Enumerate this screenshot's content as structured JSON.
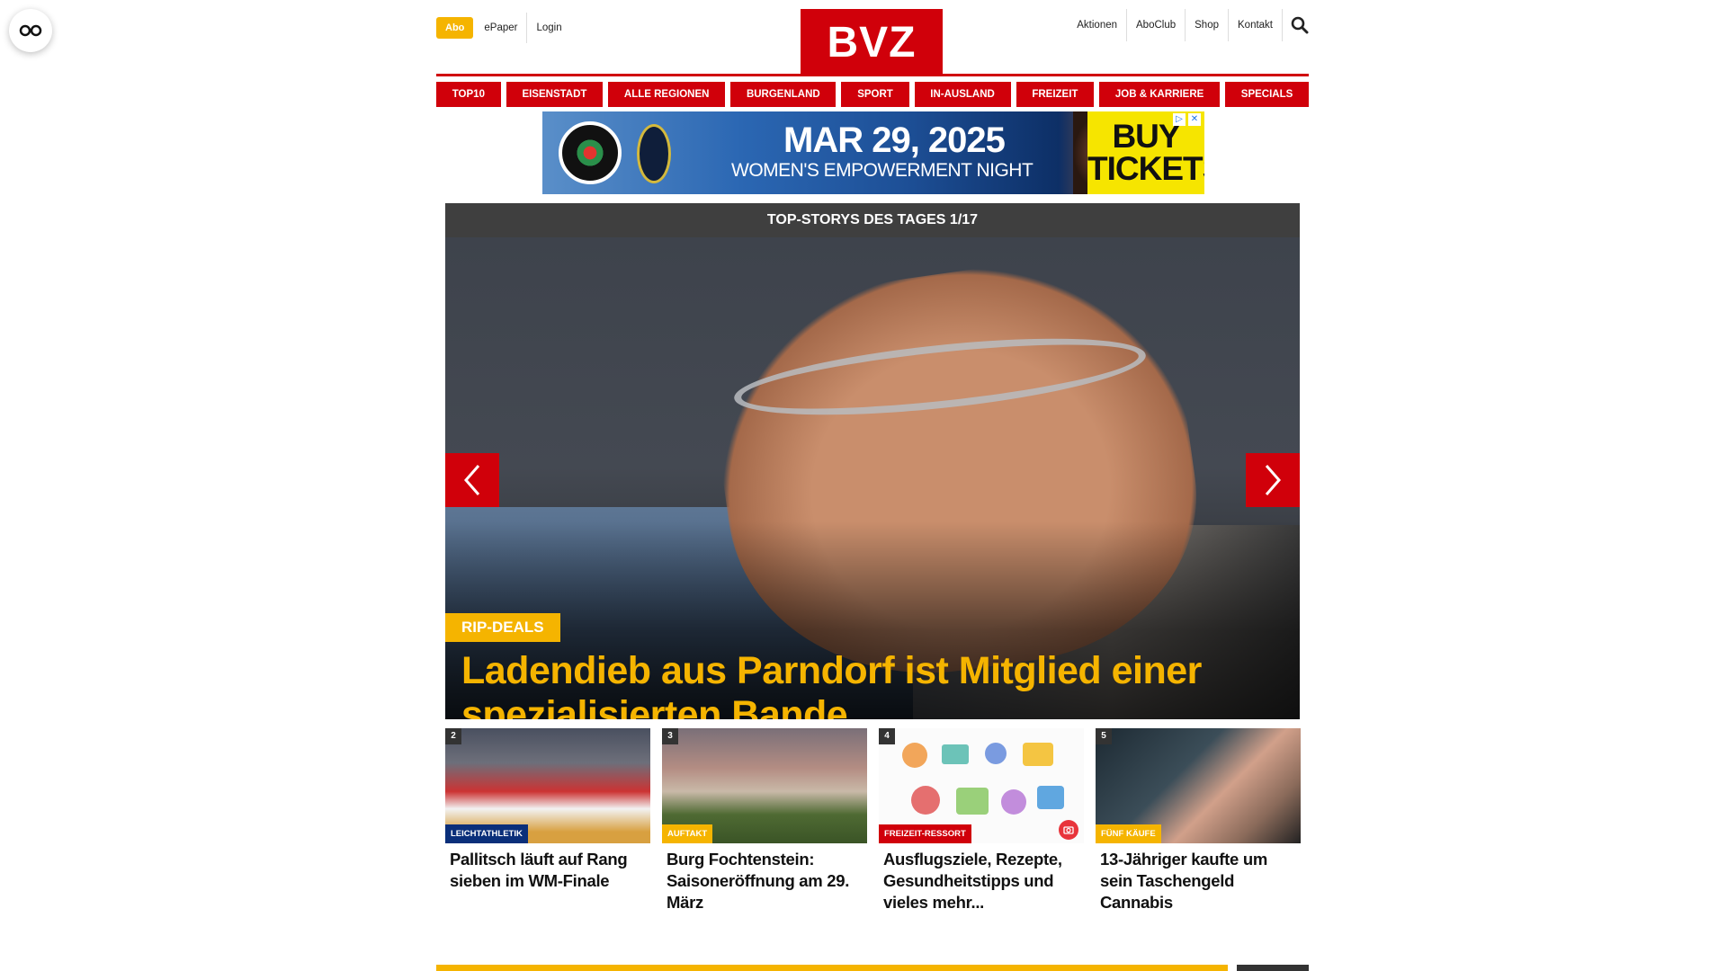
{
  "header": {
    "abo_label": "Abo",
    "left_links": [
      "ePaper",
      "Login"
    ],
    "logo_text": "BVZ",
    "right_links": [
      "Aktionen",
      "AboClub",
      "Shop",
      "Kontakt"
    ]
  },
  "nav": {
    "items": [
      "TOP10",
      "EISENSTADT",
      "ALLE REGIONEN",
      "BURGENLAND",
      "SPORT",
      "IN-AUSLAND",
      "FREIZEIT",
      "JOB & KARRIERE",
      "SPECIALS"
    ]
  },
  "ad": {
    "date": "MAR 29, 2025",
    "subtitle": "WOMEN'S EMPOWERMENT NIGHT",
    "cta_line1": "BUY",
    "cta_line2": "TICKETS"
  },
  "hero": {
    "header": "TOP-STORYS DES TAGES 1/17",
    "kicker": "RIP-DEALS",
    "title": "Ladendieb aus Parndorf ist Mitglied einer spezialisierten Bande"
  },
  "cards": [
    {
      "num": "2",
      "category": "LEICHTATHLETIK",
      "category_color": "#0a2f7a",
      "title": "Pallitsch läuft auf Rang sieben im WM-Finale"
    },
    {
      "num": "3",
      "category": "AUFTAKT",
      "category_color": "#f5b400",
      "title": "Burg Fochtenstein: Saisoneröffnung am 29. März"
    },
    {
      "num": "4",
      "category": "FREIZEIT-RESSORT",
      "category_color": "#d0000a",
      "title": "Ausflugsziele, Rezepte, Gesundheitstipps und vieles mehr..."
    },
    {
      "num": "5",
      "category": "FÜNF KÄUFE",
      "category_color": "#f5b400",
      "title": "13-Jähriger kaufte um sein Taschengeld Cannabis"
    }
  ],
  "colors": {
    "brand_red": "#d0000a",
    "accent_yellow": "#f5b400",
    "dark_bar": "#3f3f3f"
  }
}
